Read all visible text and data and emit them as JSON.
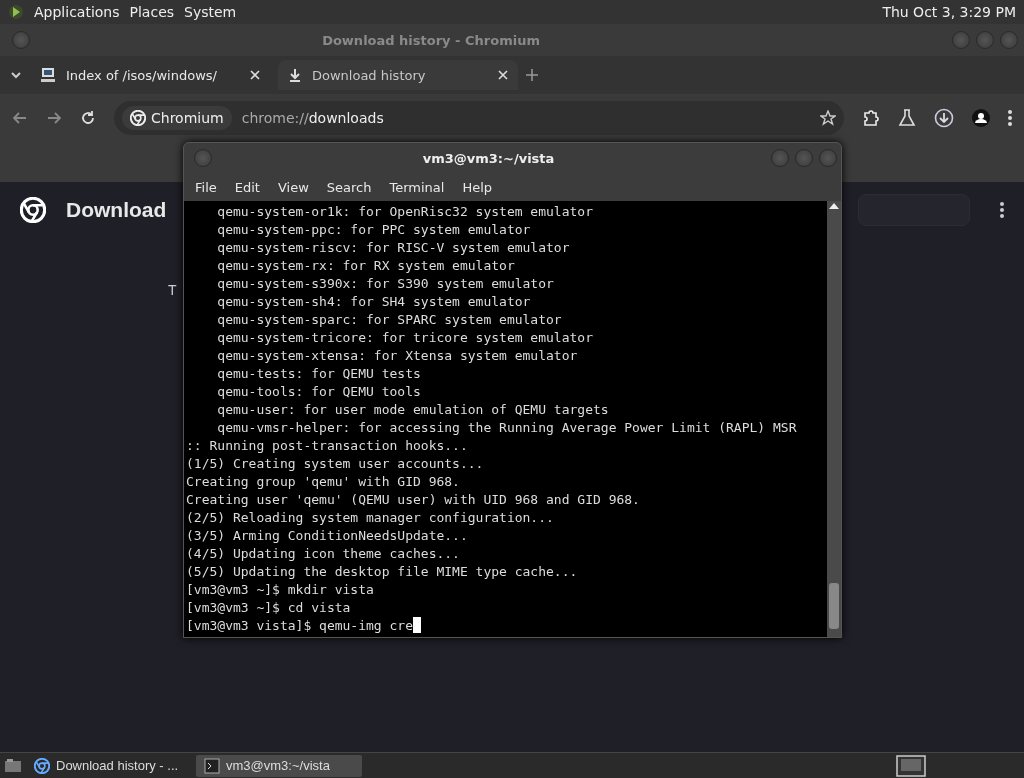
{
  "top_panel": {
    "menus": [
      "Applications",
      "Places",
      "System"
    ],
    "clock": "Thu Oct 3, 3:29 PM"
  },
  "browser": {
    "title": "Download history - Chromium",
    "tabs": [
      {
        "label": "Index of /isos/windows/",
        "selected": false
      },
      {
        "label": "Download history",
        "selected": true
      }
    ],
    "address": {
      "chip": "Chromium",
      "scheme": "chrome://",
      "path": "downloads"
    },
    "page": {
      "heading": "Download",
      "text": "T"
    }
  },
  "terminal": {
    "title": "vm3@vm3:~/vista",
    "menu": [
      "File",
      "Edit",
      "View",
      "Search",
      "Terminal",
      "Help"
    ],
    "lines": [
      "    qemu-system-or1k: for OpenRisc32 system emulator",
      "    qemu-system-ppc: for PPC system emulator",
      "    qemu-system-riscv: for RISC-V system emulator",
      "    qemu-system-rx: for RX system emulator",
      "    qemu-system-s390x: for S390 system emulator",
      "    qemu-system-sh4: for SH4 system emulator",
      "    qemu-system-sparc: for SPARC system emulator",
      "    qemu-system-tricore: for tricore system emulator",
      "    qemu-system-xtensa: for Xtensa system emulator",
      "    qemu-tests: for QEMU tests",
      "    qemu-tools: for QEMU tools",
      "    qemu-user: for user mode emulation of QEMU targets",
      "    qemu-vmsr-helper: for accessing the Running Average Power Limit (RAPL) MSR",
      ":: Running post-transaction hooks...",
      "(1/5) Creating system user accounts...",
      "Creating group 'qemu' with GID 968.",
      "Creating user 'qemu' (QEMU user) with UID 968 and GID 968.",
      "(2/5) Reloading system manager configuration...",
      "(3/5) Arming ConditionNeedsUpdate...",
      "(4/5) Updating icon theme caches...",
      "(5/5) Updating the desktop file MIME type cache...",
      "[vm3@vm3 ~]$ mkdir vista",
      "[vm3@vm3 ~]$ cd vista",
      "[vm3@vm3 vista]$ qemu-img cre"
    ]
  },
  "taskbar": {
    "items": [
      {
        "label": "Download history - ...",
        "selected": false
      },
      {
        "label": "vm3@vm3:~/vista",
        "selected": true
      }
    ]
  }
}
